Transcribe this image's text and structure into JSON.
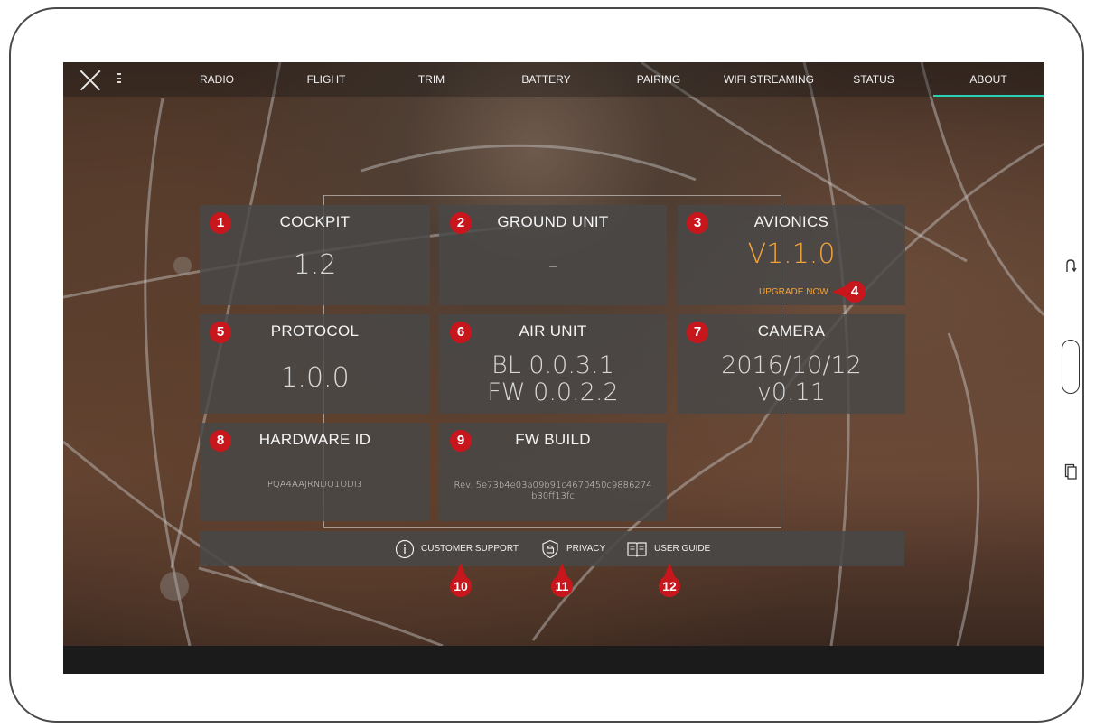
{
  "nav": {
    "tabs": [
      {
        "label": "RADIO"
      },
      {
        "label": "FLIGHT"
      },
      {
        "label": "TRIM"
      },
      {
        "label": "BATTERY"
      },
      {
        "label": "PAIRING"
      },
      {
        "label": "WIFI STREAMING"
      },
      {
        "label": "STATUS"
      },
      {
        "label": "ABOUT",
        "active": true
      }
    ]
  },
  "cards": {
    "cockpit": {
      "badge": "1",
      "title": "COCKPIT",
      "value": "1.2"
    },
    "ground_unit": {
      "badge": "2",
      "title": "GROUND UNIT",
      "value": "-"
    },
    "avionics": {
      "badge": "3",
      "title": "AVIONICS",
      "value": "V1.1.0",
      "action": "UPGRADE NOW",
      "action_badge": "4"
    },
    "protocol": {
      "badge": "5",
      "title": "PROTOCOL",
      "value": "1.0.0"
    },
    "air_unit": {
      "badge": "6",
      "title": "AIR UNIT",
      "value_line1": "BL 0.0.3.1",
      "value_line2": "FW 0.0.2.2"
    },
    "camera": {
      "badge": "7",
      "title": "CAMERA",
      "value_line1": "2016/10/12",
      "value_line2": "v0.11"
    },
    "hardware_id": {
      "badge": "8",
      "title": "HARDWARE ID",
      "value": "PQA4AAJRNDQ1ODI3"
    },
    "fw_build": {
      "badge": "9",
      "title": "FW BUILD",
      "value_line1": "Rev. 5e73b4e03a09b91c4670450c9886274",
      "value_line2": "b30ff13fc"
    }
  },
  "footer": {
    "customer_support": {
      "label": "CUSTOMER SUPPORT",
      "badge": "10",
      "icon": "info-icon"
    },
    "privacy": {
      "label": "PRIVACY",
      "badge": "11",
      "icon": "lock-shield-icon"
    },
    "user_guide": {
      "label": "USER GUIDE",
      "badge": "12",
      "icon": "book-icon"
    }
  },
  "colors": {
    "accent": "#29d1b4",
    "highlight": "#f2a33a",
    "badge": "#c8161d",
    "card": "#484848"
  }
}
